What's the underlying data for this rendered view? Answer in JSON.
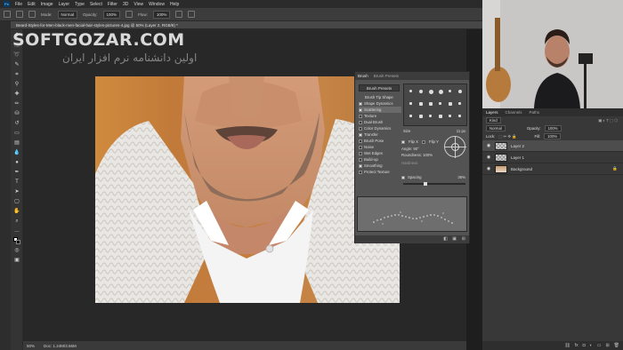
{
  "menubar": {
    "logo": "Ps",
    "items": [
      "File",
      "Edit",
      "Image",
      "Layer",
      "Type",
      "Select",
      "Filter",
      "3D",
      "View",
      "Window",
      "Help"
    ]
  },
  "options_bar": {
    "mode_label": "Mode:",
    "mode_value": "Normal",
    "opacity_label": "Opacity:",
    "opacity_value": "100%",
    "flow_label": "Flow:",
    "flow_value": "100%"
  },
  "document_tab": {
    "title": "Beard-Styles-for-Men-black-men-facial-hair-styles-pictures-4.jpg @ 50% (Layer 2, RGB/8) *"
  },
  "watermark": {
    "logo": "SOFTGOZAR.COM",
    "tagline": "اولین دانشنامه نرم افزار ایران"
  },
  "brush_panel": {
    "tab_brush": "Brush",
    "tab_presets": "Brush Presets",
    "presets_button": "Brush Presets",
    "items": [
      {
        "label": "Brush Tip Shape",
        "checked": null
      },
      {
        "label": "Shape Dynamics",
        "checked": true
      },
      {
        "label": "Scattering",
        "checked": true
      },
      {
        "label": "Texture",
        "checked": false
      },
      {
        "label": "Dual Brush",
        "checked": false
      },
      {
        "label": "Color Dynamics",
        "checked": false
      },
      {
        "label": "Transfer",
        "checked": true
      },
      {
        "label": "Brush Pose",
        "checked": false
      },
      {
        "label": "Noise",
        "checked": false
      },
      {
        "label": "Wet Edges",
        "checked": false
      },
      {
        "label": "Build-up",
        "checked": false
      },
      {
        "label": "Smoothing",
        "checked": true
      },
      {
        "label": "Protect Texture",
        "checked": false
      }
    ],
    "size_label": "Size",
    "size_value": "11 px",
    "flip_x": "Flip X",
    "flip_y": "Flip Y",
    "angle_label": "Angle:",
    "angle_value": "90°",
    "roundness_label": "Roundness:",
    "roundness_value": "100%",
    "hardness_label": "Hardness",
    "spacing_label": "Spacing",
    "spacing_value": "36%",
    "spacing_fraction": 0.36
  },
  "status_bar": {
    "zoom": "50%",
    "doc_info": "Doc: 1.24M/3.56M"
  },
  "layers_panel": {
    "tabs": [
      "Layers",
      "Channels",
      "Paths"
    ],
    "active_tab": "Layers",
    "kind_label": "Kind",
    "blend_mode": "Normal",
    "opacity_label": "Opacity:",
    "opacity_value": "100%",
    "lock_label": "Lock:",
    "fill_label": "Fill:",
    "fill_value": "100%",
    "layers": [
      {
        "name": "Layer 2",
        "active": true,
        "thumb": "transparent"
      },
      {
        "name": "Layer 1",
        "active": false,
        "thumb": "transparent"
      },
      {
        "name": "Background",
        "active": false,
        "thumb": "photo"
      }
    ],
    "footer_icons": [
      "link-icon",
      "fx-icon",
      "mask-icon",
      "adjustment-icon",
      "folder-icon",
      "new-layer-icon",
      "trash-icon"
    ]
  },
  "colors": {
    "app_bg": "#282828",
    "panel_bg": "#535353",
    "accent": "#0d3a63"
  }
}
